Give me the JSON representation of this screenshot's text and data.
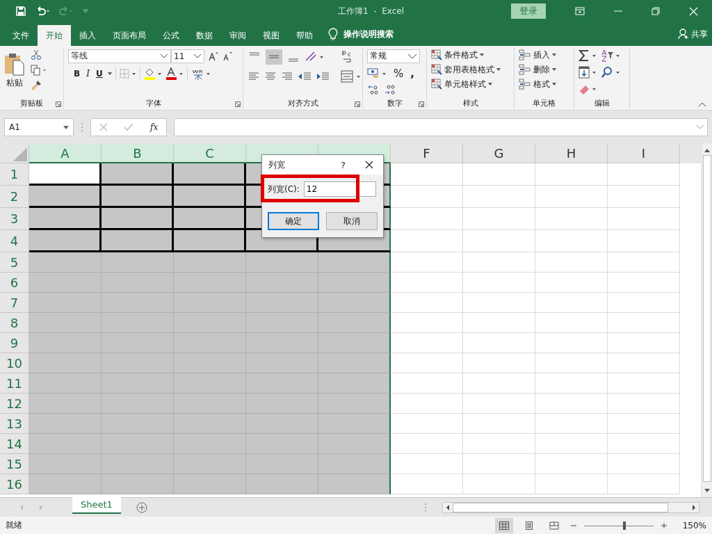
{
  "title_bar": {
    "title": "工作簿1  -  Excel",
    "login_button": "登录"
  },
  "menu_tabs": [
    {
      "label": "文件",
      "selected": false
    },
    {
      "label": "开始",
      "selected": true
    },
    {
      "label": "插入",
      "selected": false
    },
    {
      "label": "页面布局",
      "selected": false
    },
    {
      "label": "公式",
      "selected": false
    },
    {
      "label": "数据",
      "selected": false
    },
    {
      "label": "审阅",
      "selected": false
    },
    {
      "label": "视图",
      "selected": false
    },
    {
      "label": "帮助",
      "selected": false
    }
  ],
  "tell_me": "操作说明搜索",
  "share": "共享",
  "ribbon": {
    "clipboard": {
      "paste": "粘贴",
      "label": "剪贴板"
    },
    "font": {
      "font_name": "等线",
      "font_size": "11",
      "bold": "B",
      "italic": "I",
      "underline": "U",
      "label": "字体"
    },
    "alignment": {
      "label": "对齐方式"
    },
    "number": {
      "format": "常规",
      "percent": "%",
      "comma": ",",
      "label": "数字"
    },
    "styles": {
      "items": [
        "条件格式",
        "套用表格格式",
        "单元格样式"
      ],
      "label": "样式"
    },
    "cells": {
      "items": [
        "插入",
        "删除",
        "格式"
      ],
      "label": "单元格"
    },
    "editing": {
      "label": "编辑"
    }
  },
  "formula_bar": {
    "name_box": "A1",
    "fx": "fx"
  },
  "sheet": {
    "columns": [
      {
        "label": "A",
        "selected": true
      },
      {
        "label": "B",
        "selected": true
      },
      {
        "label": "C",
        "selected": true
      },
      {
        "selected": true
      },
      {
        "selected": true
      },
      {
        "label": "F",
        "selected": false
      },
      {
        "label": "G",
        "selected": false
      },
      {
        "label": "H",
        "selected": false
      },
      {
        "label": "I",
        "selected": false
      }
    ],
    "rows": [
      {
        "label": "1",
        "active": true,
        "bordered": true
      },
      {
        "label": "2",
        "active": false,
        "bordered": true
      },
      {
        "label": "3",
        "active": false,
        "bordered": true
      },
      {
        "label": "4",
        "active": false,
        "bordered": true
      },
      {
        "label": "5",
        "active": false,
        "bordered": false
      },
      {
        "label": "6",
        "active": false,
        "bordered": false
      },
      {
        "label": "7",
        "active": false,
        "bordered": false
      },
      {
        "label": "8",
        "active": false,
        "bordered": false
      },
      {
        "label": "9",
        "active": false,
        "bordered": false
      },
      {
        "label": "10",
        "active": false,
        "bordered": false
      },
      {
        "label": "11",
        "active": false,
        "bordered": false
      },
      {
        "label": "12",
        "active": false,
        "bordered": false
      },
      {
        "label": "13",
        "active": false,
        "bordered": false
      },
      {
        "label": "14",
        "active": false,
        "bordered": false
      },
      {
        "label": "15",
        "active": false,
        "bordered": false
      },
      {
        "label": "16",
        "active": false,
        "bordered": false
      }
    ]
  },
  "dialog": {
    "title": "列宽",
    "help": "?",
    "field_label": "列宽(C):",
    "value": "12",
    "highlighted": true,
    "buttons": [
      {
        "label": "确定",
        "default": true
      },
      {
        "label": "取消",
        "default": false
      }
    ]
  },
  "sheet_tabs": [
    {
      "label": "Sheet1",
      "selected": true
    }
  ],
  "status_bar": {
    "status": "就绪",
    "views": [
      {
        "kind": "normal",
        "selected": true
      },
      {
        "kind": "layout",
        "selected": false
      },
      {
        "kind": "pagebreak",
        "selected": false
      }
    ],
    "zoom": {
      "level": 0.58
    },
    "zoom_label": "150%"
  }
}
